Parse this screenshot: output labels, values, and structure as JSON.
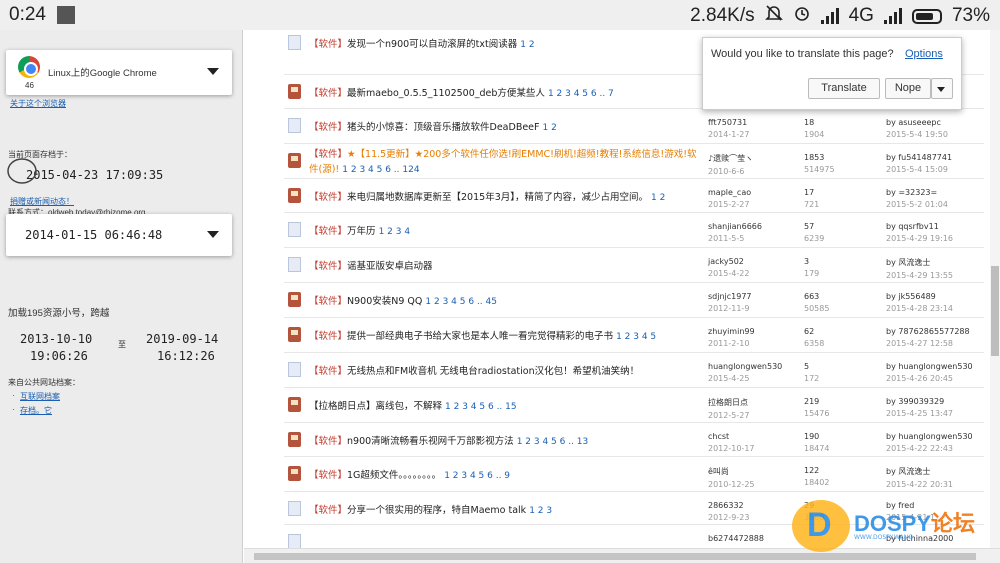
{
  "status": {
    "time": "0:24",
    "speed": "2.84K/s",
    "network": "4G",
    "battery": "73%"
  },
  "sidebar": {
    "browser_name": "Linux上的Google Chrome",
    "browser_version": "46",
    "about_link": "关于这个浏览器",
    "saved_label": "当前页面存档于：",
    "saved_date": "2015-04-23  17:09:35",
    "contact_link": "捐赠或新闻动态！",
    "contact_text": "联系方式：oldweb.today@rhizome.org",
    "archive_date": "2014-01-15  06:46:48",
    "load_text": "加载195资源小号，跨越",
    "range_from_date": "2013-10-10",
    "range_from_time": "19:06:26",
    "range_to_label": "至",
    "range_to_date": "2019-09-14",
    "range_to_time": "16:12:26",
    "source_label": "来自公共网站档案：",
    "sources": [
      "互联网档案",
      "存档。它"
    ]
  },
  "popup": {
    "question": "Would you like to translate this page?",
    "options_link": "Options",
    "translate_button": "Translate",
    "nope_button": "Nope"
  },
  "rows": [
    {
      "icon": "doc",
      "cat": "【软件】",
      "title": "发现一个n900可以自动滚屏的txt阅读器",
      "pages": "1 2",
      "author": "",
      "date": "",
      "replies": "",
      "views": "",
      "last": "",
      "last_date": ""
    },
    {
      "icon": "box",
      "cat": "【软件】",
      "title": "最新maebo_0.5.5_1102500_deb方便某些人",
      "pages": "1 2 3 4 5 6 .. 7",
      "author": "",
      "date": "",
      "replies": "",
      "views": "",
      "last": "",
      "last_date": ""
    },
    {
      "icon": "doc",
      "cat": "【软件】",
      "title": "猪头的小惊喜：顶级音乐播放软件DeaDBeeF",
      "pages": "1 2",
      "author": "fft750731",
      "date": "2014-1-27",
      "replies": "18",
      "views": "1904",
      "last": "by asuseeepc",
      "last_date": "2015-5-4 19:50"
    },
    {
      "icon": "box",
      "cat": "【软件】",
      "title": "★【11.5更新】★200多个软件任你选!刷EMMC!刷机!超频!教程!系统信息!游戏!软件(源)!",
      "pages": "1 2 3 4 5 6 .. 124",
      "author": "♪遗赎⌒莹ヽ",
      "date": "2010-6-6",
      "replies": "1853",
      "views": "514975",
      "last": "by fu541487741",
      "last_date": "2015-5-4 15:09",
      "hot": true
    },
    {
      "icon": "box",
      "cat": "【软件】",
      "title": "来电归属地数据库更新至【2015年3月】，精简了内容，减少占用空间。",
      "pages": "1 2",
      "author": "maple_cao",
      "date": "2015-2-27",
      "replies": "17",
      "views": "721",
      "last": "by =32323=",
      "last_date": "2015-5-2 01:04"
    },
    {
      "icon": "doc",
      "cat": "【软件】",
      "title": "万年历",
      "pages": "1 2 3 4",
      "author": "shanjian6666",
      "date": "2011-5-5",
      "replies": "57",
      "views": "6239",
      "last": "by qqsrfbv11",
      "last_date": "2015-4-29 19:16"
    },
    {
      "icon": "doc",
      "cat": "【软件】",
      "title": "谣基亚版安卓启动器",
      "pages": "",
      "author": "jacky502",
      "date": "2015-4-22",
      "replies": "3",
      "views": "179",
      "last": "by 风流逸士",
      "last_date": "2015-4-29 13:55"
    },
    {
      "icon": "box",
      "cat": "【软件】",
      "title": "N900安装N9 QQ",
      "pages": "1 2 3 4 5 6 .. 45",
      "author": "sdjnjc1977",
      "date": "2012-11-9",
      "replies": "663",
      "views": "50585",
      "last": "by jk556489",
      "last_date": "2015-4-28 23:14"
    },
    {
      "icon": "box",
      "cat": "【软件】",
      "title": "提供一部经典电子书给大家也是本人唯一看完觉得精彩的电子书",
      "pages": "1 2 3 4 5",
      "author": "zhuyimin99",
      "date": "2011-2-10",
      "replies": "62",
      "views": "6358",
      "last": "by 78762865577288",
      "last_date": "2015-4-27 12:58"
    },
    {
      "icon": "doc",
      "cat": "【软件】",
      "title": "无线热点和FM收音机 无线电台radiostation汉化包！希望机油笑纳！",
      "pages": "",
      "author": "huanglongwen530",
      "date": "2015-4-25",
      "replies": "5",
      "views": "172",
      "last": "by huanglongwen530",
      "last_date": "2015-4-26 20:45"
    },
    {
      "icon": "box",
      "cat": "",
      "title": "【拉格朗日点】离线包，不解释",
      "pages": "1 2 3 4 5 6 .. 15",
      "author": "拉格朗日点",
      "date": "2012-5-27",
      "replies": "219",
      "views": "15476",
      "last": "by 399039329",
      "last_date": "2015-4-25 13:47"
    },
    {
      "icon": "box",
      "cat": "【软件】",
      "title": "n900清晰流畅看乐视网千万部影视方法",
      "pages": "1 2 3 4 5 6 .. 13",
      "author": "chcst",
      "date": "2012-10-17",
      "replies": "190",
      "views": "18474",
      "last": "by huanglongwen530",
      "last_date": "2015-4-22 22:43"
    },
    {
      "icon": "box",
      "cat": "【软件】",
      "title": "1G超频文件。。。。。。。。",
      "pages": "1 2 3 4 5 6 .. 9",
      "author": "ê叫尚",
      "date": "2010-12-25",
      "replies": "122",
      "views": "18402",
      "last": "by 风流逸士",
      "last_date": "2015-4-22 20:31"
    },
    {
      "icon": "doc",
      "cat": "【软件】",
      "title": "分享一个很实用的程序，特自Maemo talk",
      "pages": "1 2 3",
      "author": "2866332",
      "date": "2012-9-23",
      "replies": "29",
      "views": "3860",
      "last": "by fred",
      "last_date": "2015-4-21 1"
    },
    {
      "icon": "doc",
      "cat": "",
      "title": "",
      "pages": "",
      "author": "b6274472888",
      "date": "",
      "replies": "",
      "views": "",
      "last": "by fuchinna2000",
      "last_date": ""
    }
  ],
  "watermark": {
    "brand": "DOSPY",
    "cn": "论坛",
    "url": "WWW.DOSPY.WANG"
  }
}
